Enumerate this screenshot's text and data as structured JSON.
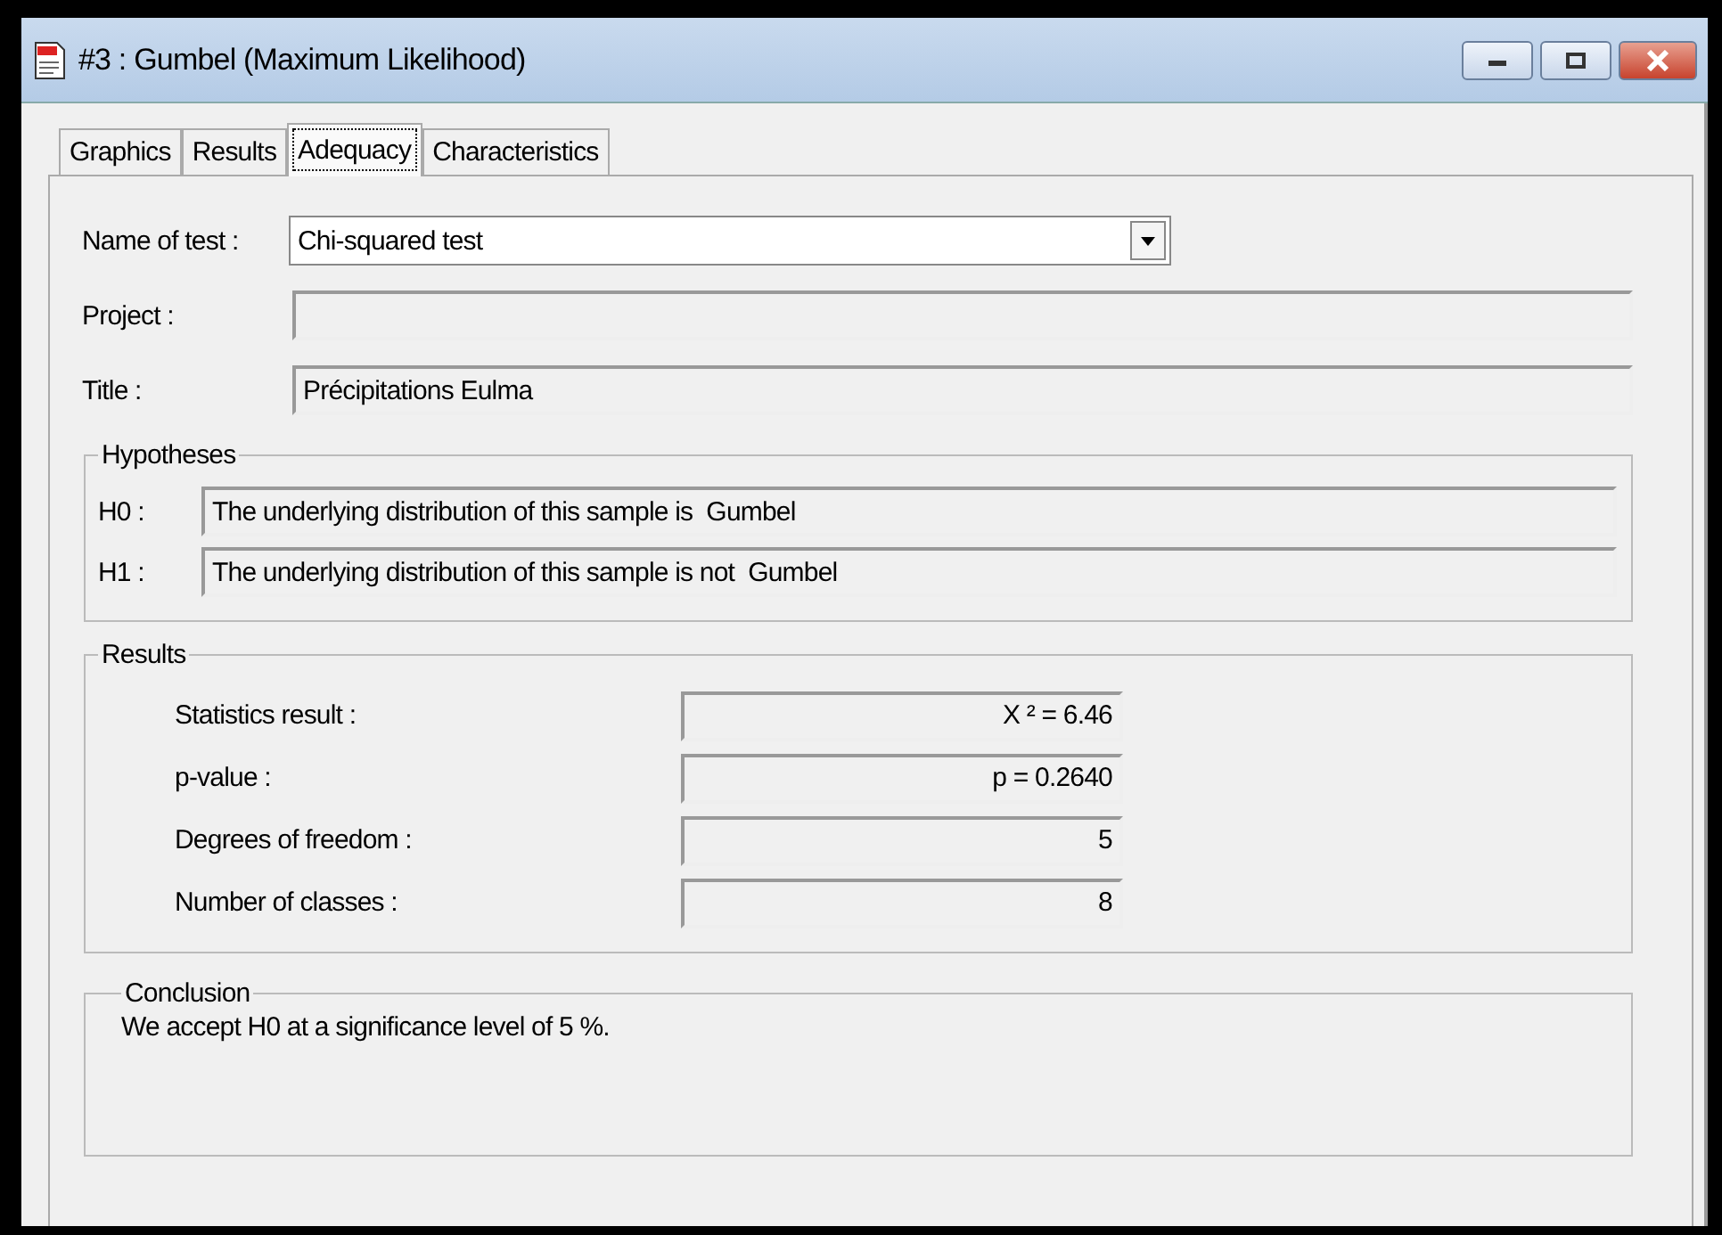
{
  "window": {
    "title": "#3 : Gumbel (Maximum Likelihood)"
  },
  "tabs": [
    {
      "label": "Graphics",
      "selected": false
    },
    {
      "label": "Results",
      "selected": false
    },
    {
      "label": "Adequacy",
      "selected": true
    },
    {
      "label": "Characteristics",
      "selected": false
    }
  ],
  "test": {
    "label": "Name of test :",
    "value": "Chi-squared test"
  },
  "fields": [
    {
      "label": "Project :"
    },
    {
      "label": "Title :",
      "value": "Précipitations Eulma"
    }
  ],
  "hypotheses": {
    "title": "Hypotheses",
    "rows": [
      {
        "label": "H0 :",
        "value": "The underlying distribution of this sample is  Gumbel"
      },
      {
        "label": "H1 :",
        "value": "The underlying distribution of this sample is not  Gumbel"
      }
    ]
  },
  "results": {
    "title": "Results",
    "rows": [
      {
        "label": "Statistics result :",
        "value": "X ² = 6.46"
      },
      {
        "label": "p-value :",
        "value": "p = 0.2640"
      },
      {
        "label": "Degrees of freedom :",
        "value": "5"
      },
      {
        "label": "Number of classes :",
        "value": "8"
      }
    ]
  },
  "conclusion": {
    "title": "Conclusion",
    "text": "We accept H0 at a significance level of 5 %."
  }
}
